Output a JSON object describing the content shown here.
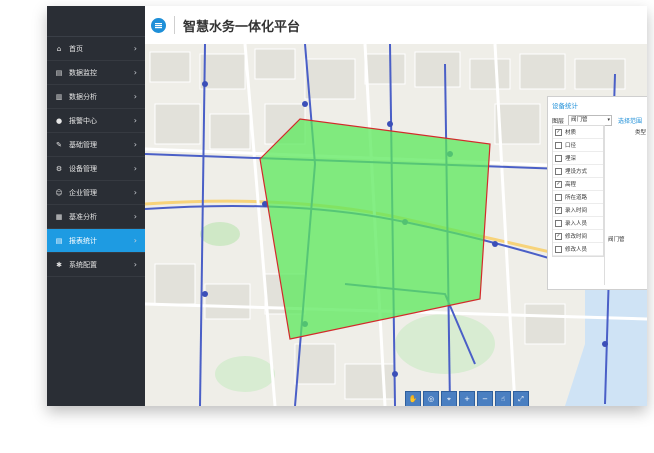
{
  "app": {
    "title": "智慧水务一体化平台"
  },
  "sidebar": {
    "items": [
      {
        "label": "首页",
        "icon": "home-icon"
      },
      {
        "label": "数据监控",
        "icon": "monitor-icon"
      },
      {
        "label": "数据分析",
        "icon": "bar-chart-icon"
      },
      {
        "label": "报警中心",
        "icon": "alert-icon"
      },
      {
        "label": "基础管理",
        "icon": "wrench-icon"
      },
      {
        "label": "设备管理",
        "icon": "device-icon"
      },
      {
        "label": "企业管理",
        "icon": "users-icon"
      },
      {
        "label": "基准分析",
        "icon": "analysis-icon"
      },
      {
        "label": "报表统计",
        "icon": "report-icon",
        "active": true
      },
      {
        "label": "系统配置",
        "icon": "gear-icon"
      }
    ]
  },
  "panel": {
    "title": "设备统计",
    "layer_label": "图层",
    "layer_value": "阀门管",
    "select_range_label": "选择范围",
    "fields": [
      {
        "label": "材质",
        "checked": true
      },
      {
        "label": "口径",
        "checked": false
      },
      {
        "label": "埋深",
        "checked": false
      },
      {
        "label": "埋设方式",
        "checked": false
      },
      {
        "label": "高程",
        "checked": true
      },
      {
        "label": "所在道路",
        "checked": false
      },
      {
        "label": "录入时间",
        "checked": true
      },
      {
        "label": "录入人员",
        "checked": false
      },
      {
        "label": "修改时间",
        "checked": true
      },
      {
        "label": "修改人员",
        "checked": false
      }
    ],
    "right_col_top": "类型",
    "right_col_value": "阀门管"
  },
  "colors": {
    "accent": "#1e9be2",
    "sidebar_bg": "#2a2e35",
    "polygon_fill": "#5be85b",
    "polygon_stroke": "#d22b2b"
  }
}
